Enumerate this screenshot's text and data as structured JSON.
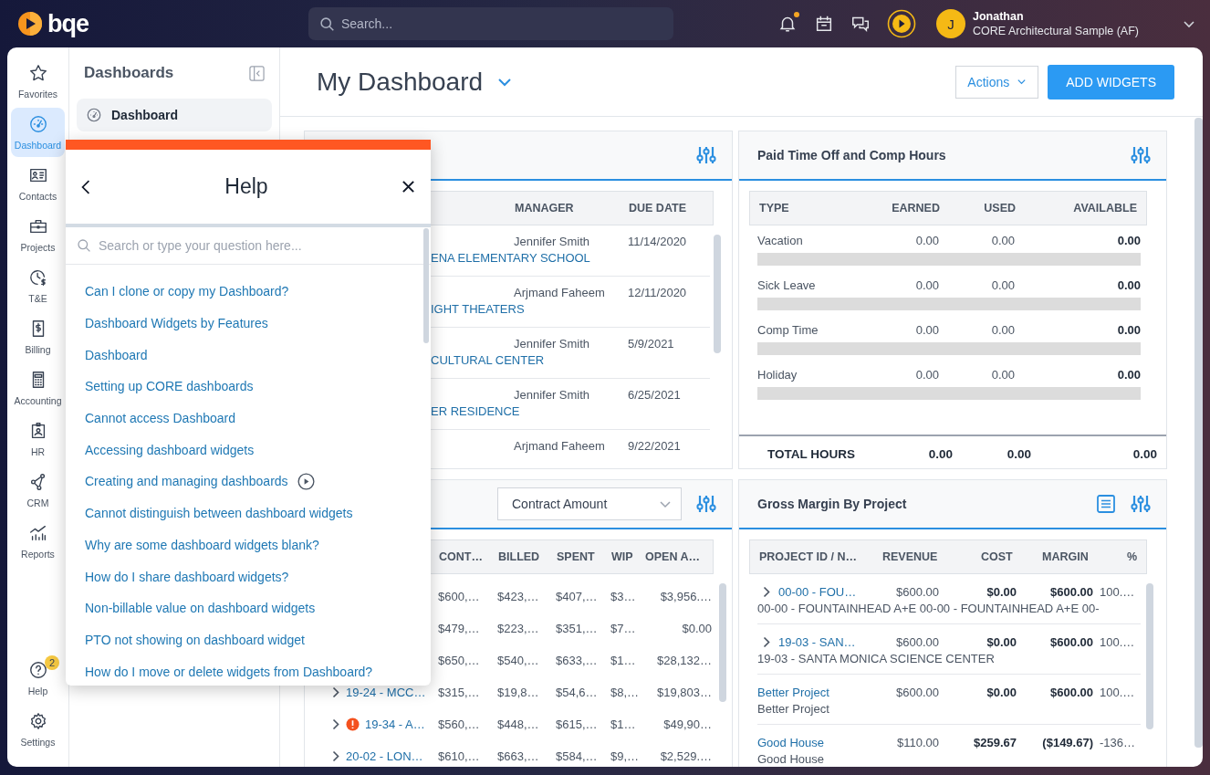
{
  "topbar": {
    "brand": "bqe",
    "search": {
      "placeholder": "Search..."
    },
    "notifications": {
      "unread": true
    },
    "user": {
      "initial": "J",
      "name": "Jonathan",
      "company": "CORE Architectural Sample (AF)"
    }
  },
  "nav": {
    "items": [
      {
        "label": "Favorites",
        "selected": false
      },
      {
        "label": "Dashboard",
        "selected": true
      },
      {
        "label": "Contacts",
        "selected": false
      },
      {
        "label": "Projects",
        "selected": false
      },
      {
        "label": "T&E",
        "selected": false
      },
      {
        "label": "Billing",
        "selected": false
      },
      {
        "label": "Accounting",
        "selected": false
      },
      {
        "label": "HR",
        "selected": false
      },
      {
        "label": "CRM",
        "selected": false
      },
      {
        "label": "Reports",
        "selected": false
      }
    ],
    "footer_items": [
      {
        "label": "Help",
        "selected": false,
        "badge": "2"
      },
      {
        "label": "Settings",
        "selected": false
      }
    ]
  },
  "sidebar": {
    "title": "Dashboards",
    "items": [
      {
        "label": "Dashboard",
        "selected": true
      }
    ]
  },
  "page": {
    "title": "My Dashboard",
    "actions": "Actions",
    "add_button": "ADD WIDGETS"
  },
  "projects_due_widget": {
    "columns": [
      "MANAGER",
      "DUE DATE"
    ],
    "rows": [
      {
        "name": "ENA ELEMENTARY SCHOOL",
        "manager": "Jennifer Smith",
        "due": "11/14/2020"
      },
      {
        "name": "IGHT THEATERS",
        "manager": "Arjmand Faheem",
        "due": "12/11/2020"
      },
      {
        "name": "CULTURAL CENTER",
        "manager": "Jennifer Smith",
        "due": "5/9/2021"
      },
      {
        "name": "ER RESIDENCE",
        "manager": "Jennifer Smith",
        "due": "6/25/2021"
      },
      {
        "manager": "Arjmand Faheem",
        "due": "9/22/2021"
      }
    ]
  },
  "contract_widget": {
    "dropdown": "Contract Amount",
    "columns": [
      "CONT…",
      "BILLED",
      "SPENT",
      "WIP",
      "OPEN A…"
    ],
    "rows": [
      {
        "values": [
          "$600,…",
          "$423,…",
          "$407,…",
          "$3…",
          "$3,956.…"
        ]
      },
      {
        "values": [
          "$479,…",
          "$223,…",
          "$351,…",
          "$7…",
          "$0.00"
        ]
      },
      {
        "values": [
          "$650,…",
          "$540,…",
          "$633,…",
          "$1…",
          "$28,132…"
        ]
      },
      {
        "project": "19-24 - MCC…",
        "alert": false,
        "values": [
          "$315,…",
          "$19,8…",
          "$54,6…",
          "$8,…",
          "$19,803…"
        ]
      },
      {
        "project": "19-34 - A…",
        "alert": true,
        "values": [
          "$560,…",
          "$448,…",
          "$615,…",
          "$1…",
          "$49,90…"
        ]
      },
      {
        "project": "20-02 - LON…",
        "alert": false,
        "values": [
          "$610,…",
          "$663,…",
          "$584,…",
          "$9,…",
          "$2,529.…"
        ]
      }
    ]
  },
  "pto_widget": {
    "title": "Paid Time Off and Comp Hours",
    "columns": [
      "TYPE",
      "EARNED",
      "USED",
      "AVAILABLE"
    ],
    "rows": [
      {
        "type": "Vacation",
        "earned": "0.00",
        "used": "0.00",
        "available": "0.00",
        "level": 0
      },
      {
        "type": "Sick Leave",
        "earned": "0.00",
        "used": "0.00",
        "available": "0.00",
        "level": 0
      },
      {
        "type": "Comp Time",
        "earned": "0.00",
        "used": "0.00",
        "available": "0.00",
        "level": 0
      },
      {
        "type": "Holiday",
        "earned": "0.00",
        "used": "0.00",
        "available": "0.00",
        "level": 0
      }
    ],
    "total": {
      "label": "TOTAL HOURS",
      "earned": "0.00",
      "used": "0.00",
      "available": "0.00"
    }
  },
  "margin_widget": {
    "title": "Gross Margin By Project",
    "columns": [
      "PROJECT ID / N…",
      "REVENUE",
      "COST",
      "MARGIN",
      "%"
    ],
    "rows": [
      {
        "id": "00-00 - FOU…",
        "name": "00-00 - FOUNTAINHEAD A+E 00-00 - FOUNTAINHEAD A+E 00-",
        "expandable": true,
        "revenue": "$600.00",
        "cost": "$0.00",
        "margin": "$600.00",
        "percent": "100.…"
      },
      {
        "id": "19-03 - SAN…",
        "name": "19-03 - SANTA MONICA SCIENCE CENTER",
        "expandable": true,
        "revenue": "$600.00",
        "cost": "$0.00",
        "margin": "$600.00",
        "percent": "100.…"
      },
      {
        "id": "Better Project",
        "name": "Better Project",
        "expandable": false,
        "revenue": "$600.00",
        "cost": "$0.00",
        "margin": "$600.00",
        "percent": "100.…"
      },
      {
        "id": "Good House",
        "name": "Good House",
        "expandable": false,
        "revenue": "$110.00",
        "cost": "$259.67",
        "margin": "($149.67)",
        "percent": "-136…"
      }
    ]
  },
  "help": {
    "title": "Help",
    "placeholder": "Search or type your question here...",
    "articles": [
      {
        "title": "Can I clone or copy my Dashboard?",
        "video": false
      },
      {
        "title": "Dashboard Widgets by Features",
        "video": false
      },
      {
        "title": "Dashboard",
        "video": false
      },
      {
        "title": "Setting up CORE dashboards",
        "video": false
      },
      {
        "title": "Cannot access Dashboard",
        "video": false
      },
      {
        "title": "Accessing dashboard widgets",
        "video": false
      },
      {
        "title": "Creating and managing dashboards",
        "video": true
      },
      {
        "title": "Cannot distinguish between dashboard widgets",
        "video": false
      },
      {
        "title": "Why are some dashboard widgets blank?",
        "video": false
      },
      {
        "title": "How do I share dashboard widgets?",
        "video": false
      },
      {
        "title": "Non-billable value on dashboard widgets",
        "video": false
      },
      {
        "title": "PTO not showing on dashboard widget",
        "video": false
      },
      {
        "title": "How do I move or delete widgets from Dashboard?",
        "video": false
      }
    ]
  }
}
